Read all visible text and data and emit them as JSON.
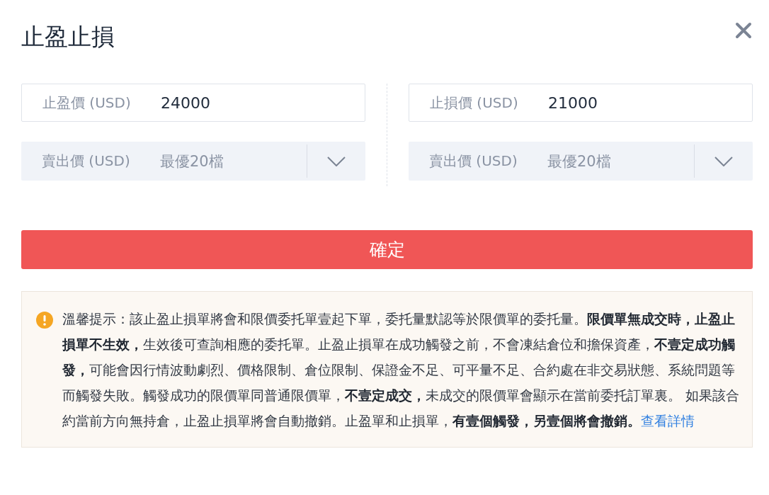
{
  "dialog": {
    "title": "止盈止損"
  },
  "columns": [
    {
      "fields": [
        {
          "kind": "input",
          "label": "止盈價 (USD)",
          "value": "24000"
        },
        {
          "kind": "select",
          "label": "賣出價 (USD)",
          "value": "最優20檔"
        }
      ]
    },
    {
      "fields": [
        {
          "kind": "input",
          "label": "止損價 (USD)",
          "value": "21000"
        },
        {
          "kind": "select",
          "label": "賣出價 (USD)",
          "value": "最優20檔"
        }
      ]
    }
  ],
  "confirm_button": "確定",
  "notice": {
    "text": "溫馨提示：該止盈止損單將會和限價委托單壹起下單，委托量默認等於限價單的委托量。**限價單無成交時，止盈止損單不生效，**生效後可查詢相應的委托單。止盈止損單在成功觸發之前，不會凍結倉位和擔保資產，**不壹定成功觸發，**可能會因行情波動劇烈、價格限制、倉位限制、保證金不足、可平量不足、合約處在非交易狀態、系統問題等而觸發失敗。觸發成功的限價單同普通限價單，**不壹定成交，**未成交的限價單會顯示在當前委托訂單裏。 如果該合約當前方向無持倉，止盈止損單將會自動撤銷。止盈單和止損單，**有壹個觸發，另壹個將會撤銷。**",
    "link": "查看詳情"
  }
}
